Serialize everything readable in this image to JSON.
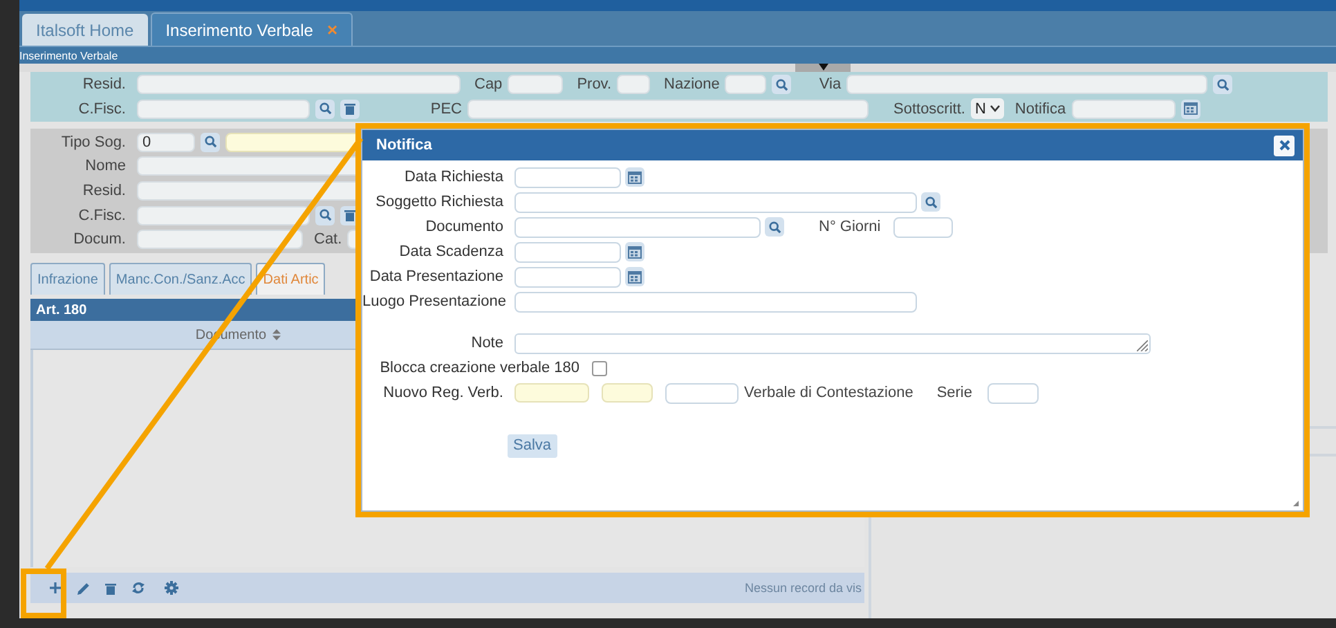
{
  "tabs": [
    {
      "label": "Italsoft Home",
      "selected": false
    },
    {
      "label": "Inserimento Verbale",
      "selected": true,
      "close": "×"
    }
  ],
  "breadcrumb": "Inserimento Verbale",
  "top_form": {
    "resid": "Resid.",
    "cap": "Cap",
    "prov": "Prov.",
    "nazione": "Nazione",
    "via": "Via",
    "cfisc": "C.Fisc.",
    "pec": "PEC",
    "sottoscritt": "Sottoscritt.",
    "sottoscritt_value": "N",
    "notifica": "Notifica"
  },
  "subject_form": {
    "tipo_sog": "Tipo Sog.",
    "tipo_sog_value": "0",
    "nome": "Nome",
    "resid": "Resid.",
    "cfisc": "C.Fisc.",
    "docum": "Docum.",
    "cat": "Cat."
  },
  "section_tabs": [
    {
      "label": "Infrazione",
      "selected": false
    },
    {
      "label": "Manc.Con./Sanz.Acc",
      "selected": false
    },
    {
      "label": "Dati Artic",
      "selected": true
    }
  ],
  "grid": {
    "title": "Art. 180",
    "column": "Documento",
    "status": "Nessun record da vis"
  },
  "dialog": {
    "title": "Notifica",
    "data_richiesta": "Data Richiesta",
    "soggetto_richiesta": "Soggetto Richiesta",
    "documento": "Documento",
    "n_giorni": "N° Giorni",
    "data_scadenza": "Data Scadenza",
    "data_presentazione": "Data Presentazione",
    "luogo_presentazione": "Luogo Presentazione",
    "note": "Note",
    "blocca": {
      "label": "Blocca creazione verbale 180",
      "checked": false
    },
    "nuovo_reg_verb": "Nuovo Reg. Verb.",
    "verbale_contestazione": "Verbale di Contestazione",
    "serie": "Serie",
    "save_button": "Salva"
  }
}
